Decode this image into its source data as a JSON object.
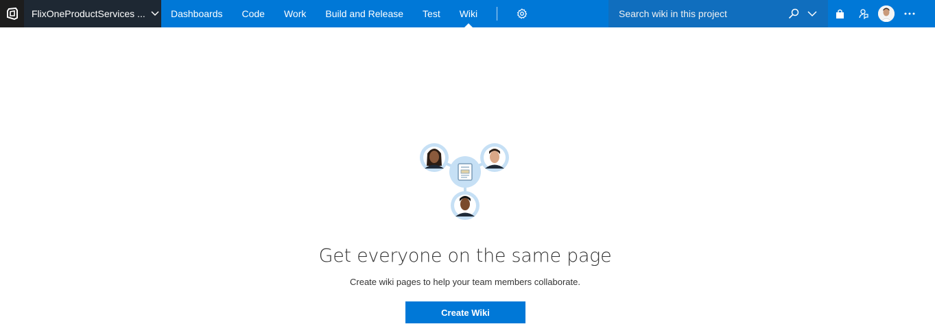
{
  "header": {
    "project_name": "FlixOneProductServices ...",
    "nav": [
      {
        "label": "Dashboards"
      },
      {
        "label": "Code"
      },
      {
        "label": "Work"
      },
      {
        "label": "Build and Release"
      },
      {
        "label": "Test"
      },
      {
        "label": "Wiki",
        "active": true
      }
    ],
    "search_placeholder": "Search wiki in this project",
    "icons": [
      "vsts-logo-icon",
      "chevron-down-icon",
      "gear-icon",
      "search-icon",
      "chevron-down-icon",
      "shopping-bag-icon",
      "feedback-icon",
      "user-avatar",
      "more-icon"
    ],
    "colors": {
      "bar": "#0078d7",
      "project_bg": "#1e2833",
      "search_bg": "#106ebe",
      "accent": "#0078d7"
    }
  },
  "main": {
    "headline": "Get everyone on the same page",
    "subtext": "Create wiki pages to help your team members collaborate.",
    "create_button": "Create Wiki"
  }
}
